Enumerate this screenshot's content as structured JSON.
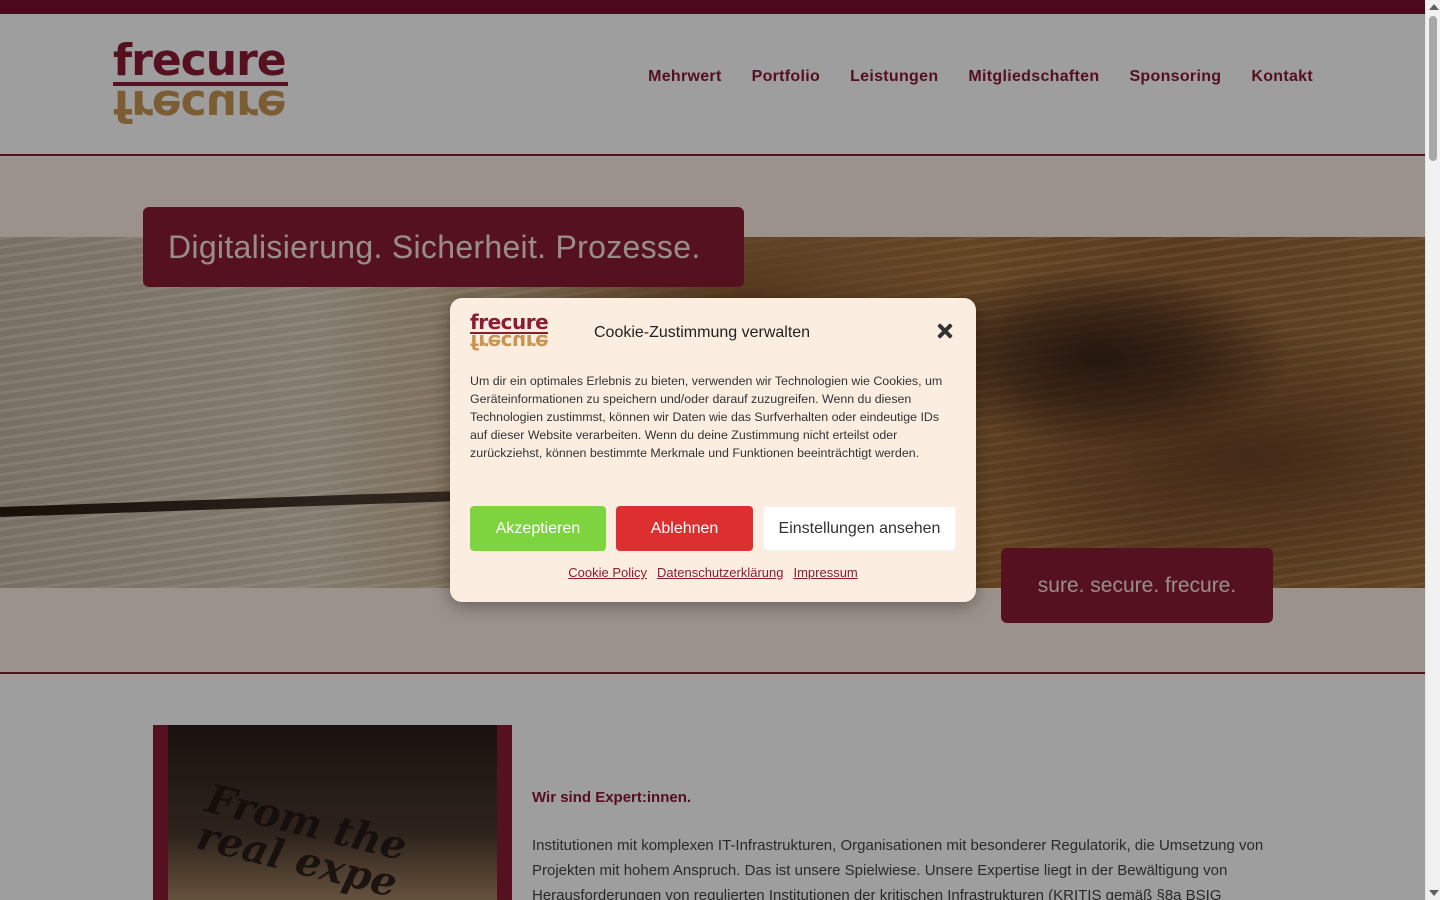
{
  "brand": {
    "logo_text": "frecure",
    "primary_color": "#8c1c34",
    "accent_color": "#c99552"
  },
  "nav": {
    "items": [
      {
        "label": "Mehrwert"
      },
      {
        "label": "Portfolio"
      },
      {
        "label": "Leistungen"
      },
      {
        "label": "Mitgliedschaften"
      },
      {
        "label": "Sponsoring"
      },
      {
        "label": "Kontakt"
      }
    ]
  },
  "hero": {
    "title": "Digitalisierung. Sicherheit. Prozesse.",
    "slogan": "sure. secure. frecure."
  },
  "content": {
    "image_text": "From the real expe",
    "heading": "Wir sind Expert:innen.",
    "text": "Institutionen mit komplexen IT-Infrastrukturen, Organisationen mit besonderer Regulatorik, die Umsetzung von Projekten mit hohem Anspruch. Das ist unsere Spielwiese. Unsere Expertise liegt in der Bewältigung von Herausforderungen von regulierten Institutionen der kritischen Infrastrukturen (KRITIS gemäß §8a BSIG"
  },
  "cookie_modal": {
    "logo_text": "frecure",
    "title": "Cookie-Zustimmung verwalten",
    "body": "Um dir ein optimales Erlebnis zu bieten, verwenden wir Technologien wie Cookies, um Geräteinformationen zu speichern und/oder darauf zuzugreifen. Wenn du diesen Technologien zustimmst, können wir Daten wie das Surfverhalten oder eindeutige IDs auf dieser Website verarbeiten. Wenn du deine Zustimmung nicht erteilst oder zurückziehst, können bestimmte Merkmale und Funktionen beeinträchtigt werden.",
    "accept_label": "Akzeptieren",
    "reject_label": "Ablehnen",
    "settings_label": "Einstellungen ansehen",
    "links": {
      "cookie_policy": "Cookie Policy",
      "privacy": "Datenschutzerklärung",
      "imprint": "Impressum"
    },
    "accept_color": "#7ed43f",
    "reject_color": "#dd2f2f"
  }
}
